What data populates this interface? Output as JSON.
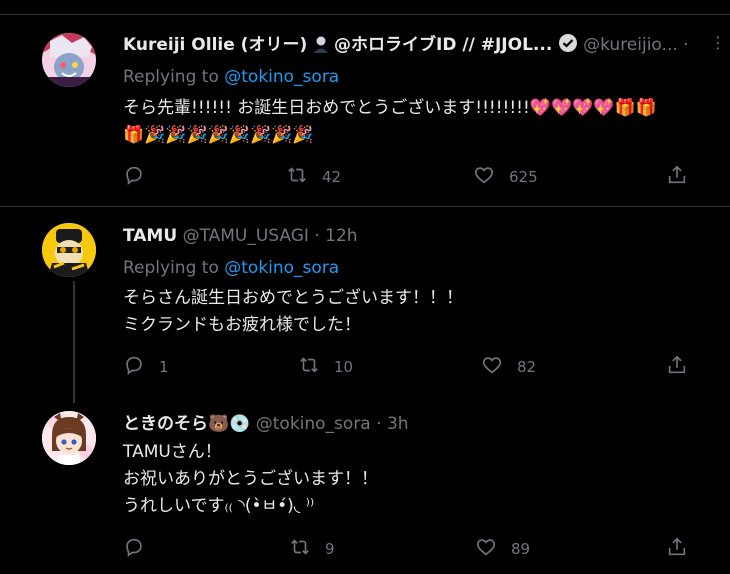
{
  "tweets": [
    {
      "name": "Kureiji Ollie (オリー)",
      "name_suffix": "@ホロライブID // #JJOL...",
      "handle": "@kureijio...",
      "dot": "·",
      "replying_prefix": "Replying to",
      "replying_handle": "@tokino_sora",
      "lines": [
        "そら先輩!!!!!! お誕生日おめでとうございます!!!!!!!!💖💖💖💖🎁🎁",
        "🎁🎉🎉🎉🎉🎉🎉🎉🎉"
      ],
      "reply_count": "",
      "retweet_count": "42",
      "like_count": "625"
    },
    {
      "name": "TAMU",
      "handle": "@TAMU_USAGI",
      "time": "· 12h",
      "replying_prefix": "Replying to",
      "replying_handle": "@tokino_sora",
      "lines": [
        "そらさん誕生日おめでとうございます！！！",
        "ミクランドもお疲れ様でした！"
      ],
      "reply_count": "1",
      "retweet_count": "10",
      "like_count": "82"
    },
    {
      "name": "ときのそら🐻💿",
      "handle": "@tokino_sora",
      "time": "· 3h",
      "lines": [
        "TAMUさん！",
        "お祝いありがとうございます！！",
        "うれしいです₍₍ ◝(•̀ㅂ•́)◟ ⁾⁾"
      ],
      "reply_count": "",
      "retweet_count": "9",
      "like_count": "89"
    }
  ],
  "colors": {
    "link": "#1d9bf0",
    "muted": "#71767b",
    "text": "#e7e9ea",
    "background": "#000000"
  },
  "icons": [
    "reply-icon",
    "retweet-icon",
    "like-icon",
    "share-icon",
    "verified-icon"
  ]
}
